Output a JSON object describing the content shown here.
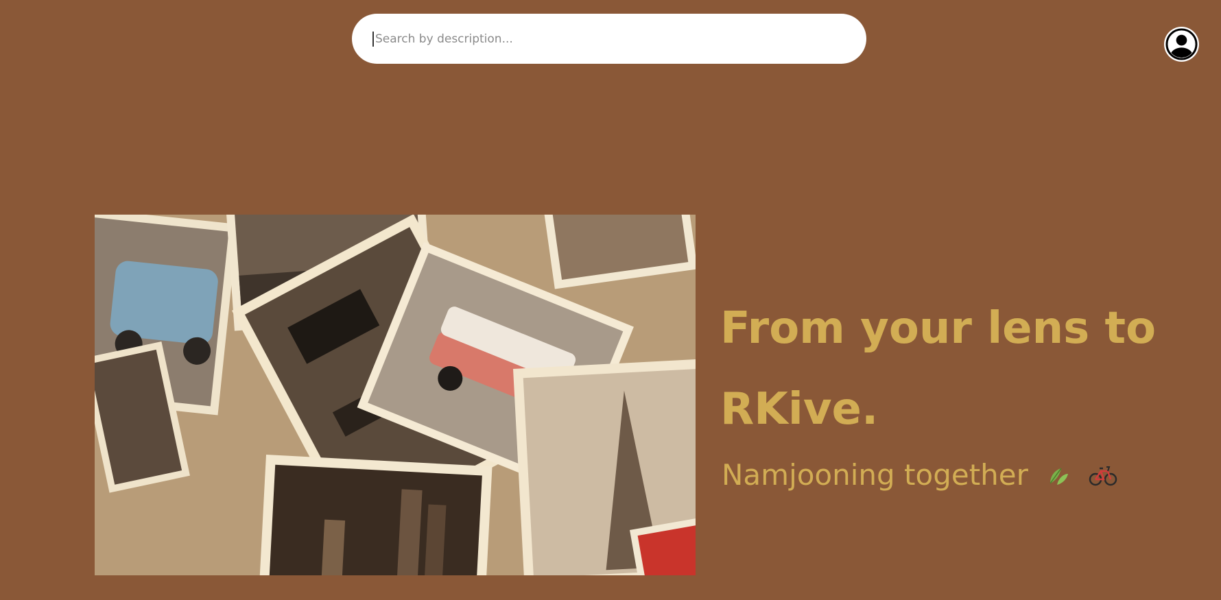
{
  "search": {
    "placeholder": "Search by description..."
  },
  "header": {
    "profile_icon": "user-circle-icon"
  },
  "hero": {
    "image_alt": "Collage of vintage sepia postcards",
    "title": "From your lens to RKive.",
    "subtitle": "Namjooning together",
    "subtitle_icons": [
      "leaf-icon",
      "bicycle-icon"
    ]
  },
  "colors": {
    "background": "#8a5837",
    "accent": "#d2ad54",
    "search_bg": "#ffffff"
  }
}
